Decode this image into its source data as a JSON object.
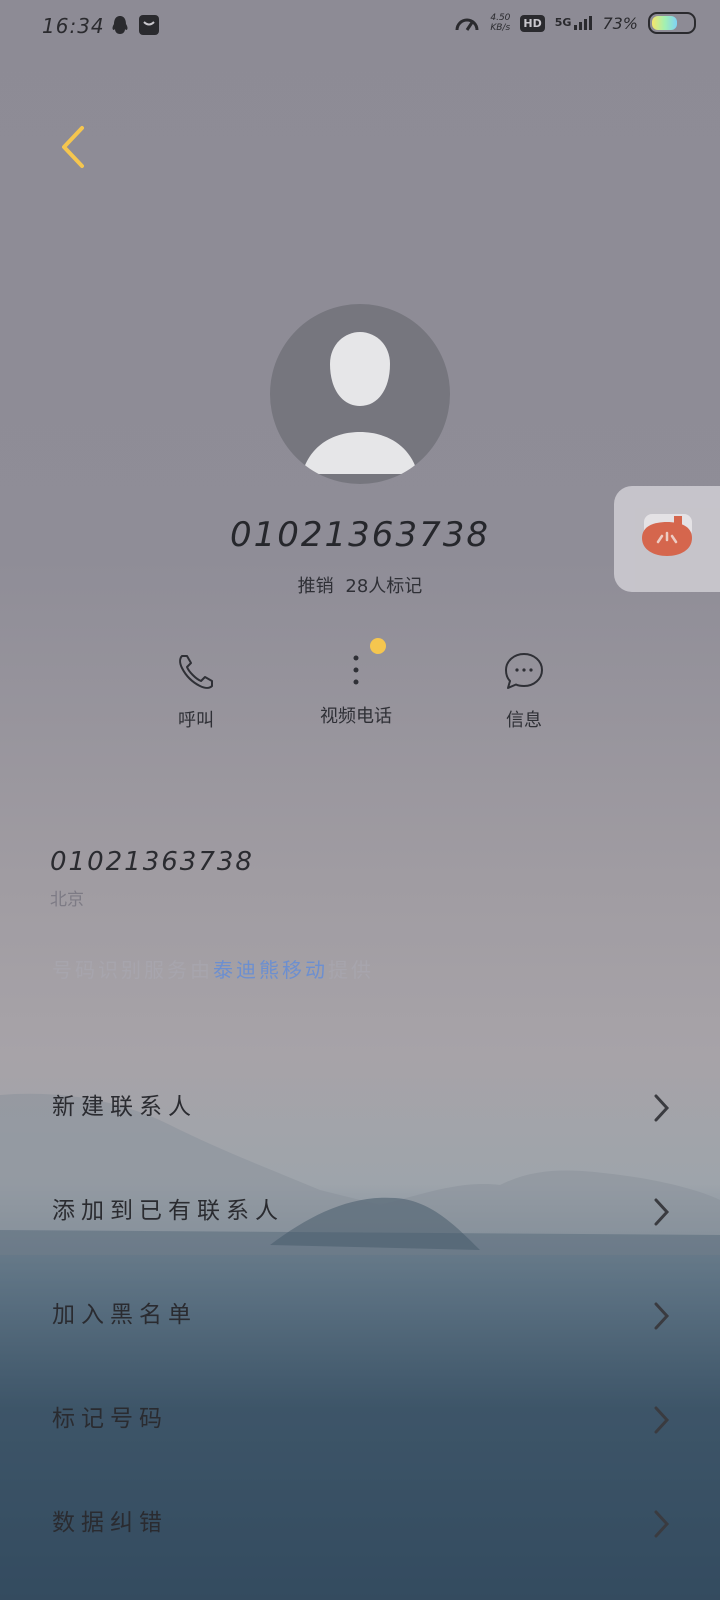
{
  "status_bar": {
    "time": "16:34",
    "net_speed_top": "4.50",
    "net_speed_bottom": "KB/s",
    "hd_label": "HD",
    "net_type": "5G",
    "battery_text": "73%",
    "battery_level": 0.73,
    "icons": [
      "qq-icon",
      "message-app-icon",
      "speedometer-icon",
      "signal-icon",
      "battery-icon"
    ]
  },
  "contact": {
    "number": "01021363738",
    "tag_label": "推销",
    "tag_count": "28人标记"
  },
  "actions": [
    {
      "label": "呼叫",
      "icon": "phone-icon"
    },
    {
      "label": "视频电话",
      "icon": "more-vertical-icon"
    },
    {
      "label": "信息",
      "icon": "chat-bubble-icon"
    }
  ],
  "details": {
    "number": "01021363738",
    "location": "北京",
    "provider_prefix": "号码识别服务由",
    "provider_name": "泰迪熊移动",
    "provider_suffix": "提供"
  },
  "menu": [
    {
      "label": "新建联系人"
    },
    {
      "label": "添加到已有联系人"
    },
    {
      "label": "加入黑名单"
    },
    {
      "label": "标记号码"
    },
    {
      "label": "数据纠错"
    }
  ],
  "colors": {
    "accent_back": "#f5c64f",
    "notification_dot": "#f5c64f",
    "link": "#6c8fd0",
    "floating_icon": "#d9644a"
  }
}
